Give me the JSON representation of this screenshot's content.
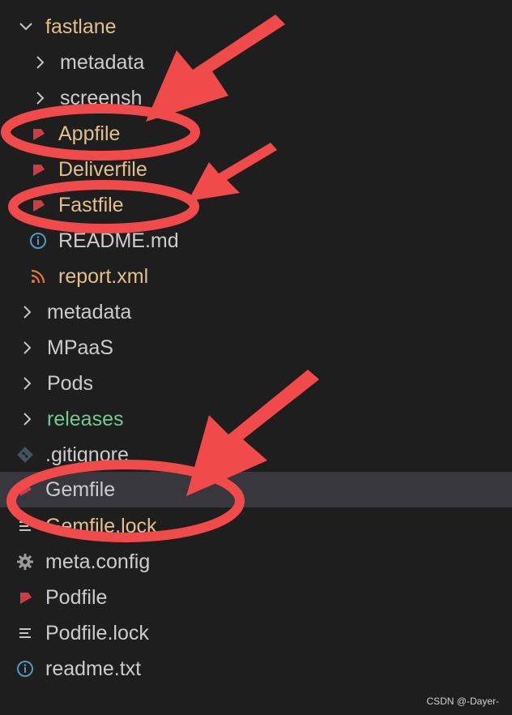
{
  "explorer": {
    "items": [
      {
        "label": "fastlane",
        "kind": "folder-open",
        "color": "yellow"
      },
      {
        "label": "metadata",
        "kind": "folder",
        "color": "white"
      },
      {
        "label": "screensh",
        "kind": "folder",
        "color": "white"
      },
      {
        "label": "Appfile",
        "kind": "ruby",
        "color": "yellow"
      },
      {
        "label": "Deliverfile",
        "kind": "ruby",
        "color": "yellow"
      },
      {
        "label": "Fastfile",
        "kind": "ruby",
        "color": "yellow"
      },
      {
        "label": "README.md",
        "kind": "info",
        "color": "white"
      },
      {
        "label": "report.xml",
        "kind": "rss",
        "color": "yellow"
      },
      {
        "label": "metadata",
        "kind": "folder",
        "color": "white"
      },
      {
        "label": "MPaaS",
        "kind": "folder",
        "color": "white"
      },
      {
        "label": "Pods",
        "kind": "folder",
        "color": "white"
      },
      {
        "label": "releases",
        "kind": "folder",
        "color": "green"
      },
      {
        "label": ".gitignore",
        "kind": "git",
        "color": "white"
      },
      {
        "label": "Gemfile",
        "kind": "plain",
        "color": "white",
        "selected": true
      },
      {
        "label": "Gemfile.lock",
        "kind": "plain",
        "color": "yellow"
      },
      {
        "label": "meta.config",
        "kind": "gear",
        "color": "white"
      },
      {
        "label": "Podfile",
        "kind": "ruby",
        "color": "white"
      },
      {
        "label": "Podfile.lock",
        "kind": "lines",
        "color": "white"
      },
      {
        "label": "readme.txt",
        "kind": "info",
        "color": "white"
      }
    ]
  },
  "colors": {
    "background": "#1e1e1e",
    "selected_row": "#37373d",
    "modified_text": "#e2c08d",
    "untracked_text": "#73c991",
    "annotation": "#f04a4a",
    "ruby_icon": "#cc3e44",
    "info_icon": "#519aba",
    "rss_icon": "#e37933"
  },
  "watermark": "CSDN @-Dayer-"
}
